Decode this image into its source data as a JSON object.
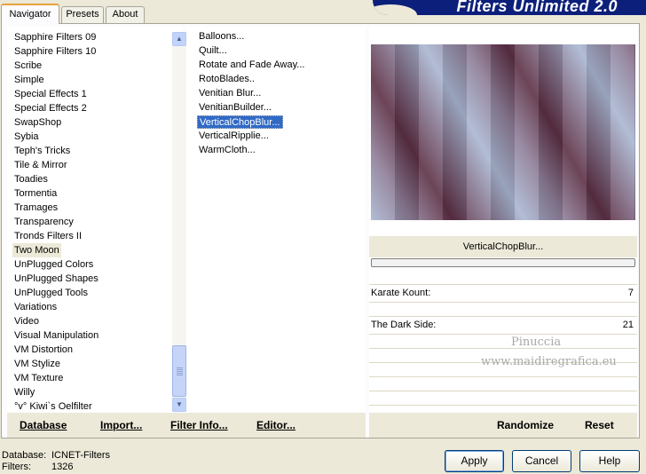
{
  "tabs": [
    {
      "label": "Navigator"
    },
    {
      "label": "Presets"
    },
    {
      "label": "About"
    }
  ],
  "banner": {
    "title": "Filters Unlimited 2.0"
  },
  "categories": {
    "items": [
      "Sapphire Filters 09",
      "Sapphire Filters 10",
      "Scribe",
      "Simple",
      "Special Effects 1",
      "Special Effects 2",
      "SwapShop",
      "Sybia",
      "Teph's Tricks",
      "Tile & Mirror",
      "Toadies",
      "Tormentia",
      "Tramages",
      "Transparency",
      "Tronds Filters II",
      "Two Moon",
      "UnPlugged Colors",
      "UnPlugged Shapes",
      "UnPlugged Tools",
      "Variations",
      "Video",
      "Visual Manipulation",
      "VM Distortion",
      "VM Stylize",
      "VM Texture",
      "Willy",
      "°v° Kiwi`s Oelfilter"
    ],
    "selected": "Two Moon"
  },
  "filters": {
    "items": [
      "Balloons...",
      "Quilt...",
      "Rotate and Fade Away...",
      "RotoBlades..",
      "Venitian Blur...",
      "VenitianBuilder...",
      "VerticalChopBlur...",
      "VerticalRipplie...",
      "WarmCloth..."
    ],
    "selected": "VerticalChopBlur..."
  },
  "preview": {
    "filter_name": "VerticalChopBlur...",
    "colors": {
      "light": "#a9b6d1",
      "dark": "#5c2f44",
      "mid": "#8d7d97"
    }
  },
  "params": [
    {
      "label": "Karate Kount:",
      "value": "7"
    },
    {
      "label": "The Dark Side:",
      "value": "21"
    }
  ],
  "watermark": {
    "line1": "Pinuccia",
    "line2": "www.maidiregrafica.eu"
  },
  "left_buttons": {
    "database": "Database",
    "import": "Import...",
    "filter_info": "Filter Info...",
    "editor": "Editor..."
  },
  "right_buttons": {
    "randomize": "Randomize",
    "reset": "Reset"
  },
  "status": {
    "database_label": "Database:",
    "database_value": "ICNET-Filters",
    "filters_label": "Filters:",
    "filters_value": "1326"
  },
  "dialog_buttons": {
    "apply": "Apply",
    "cancel": "Cancel",
    "help": "Help"
  }
}
